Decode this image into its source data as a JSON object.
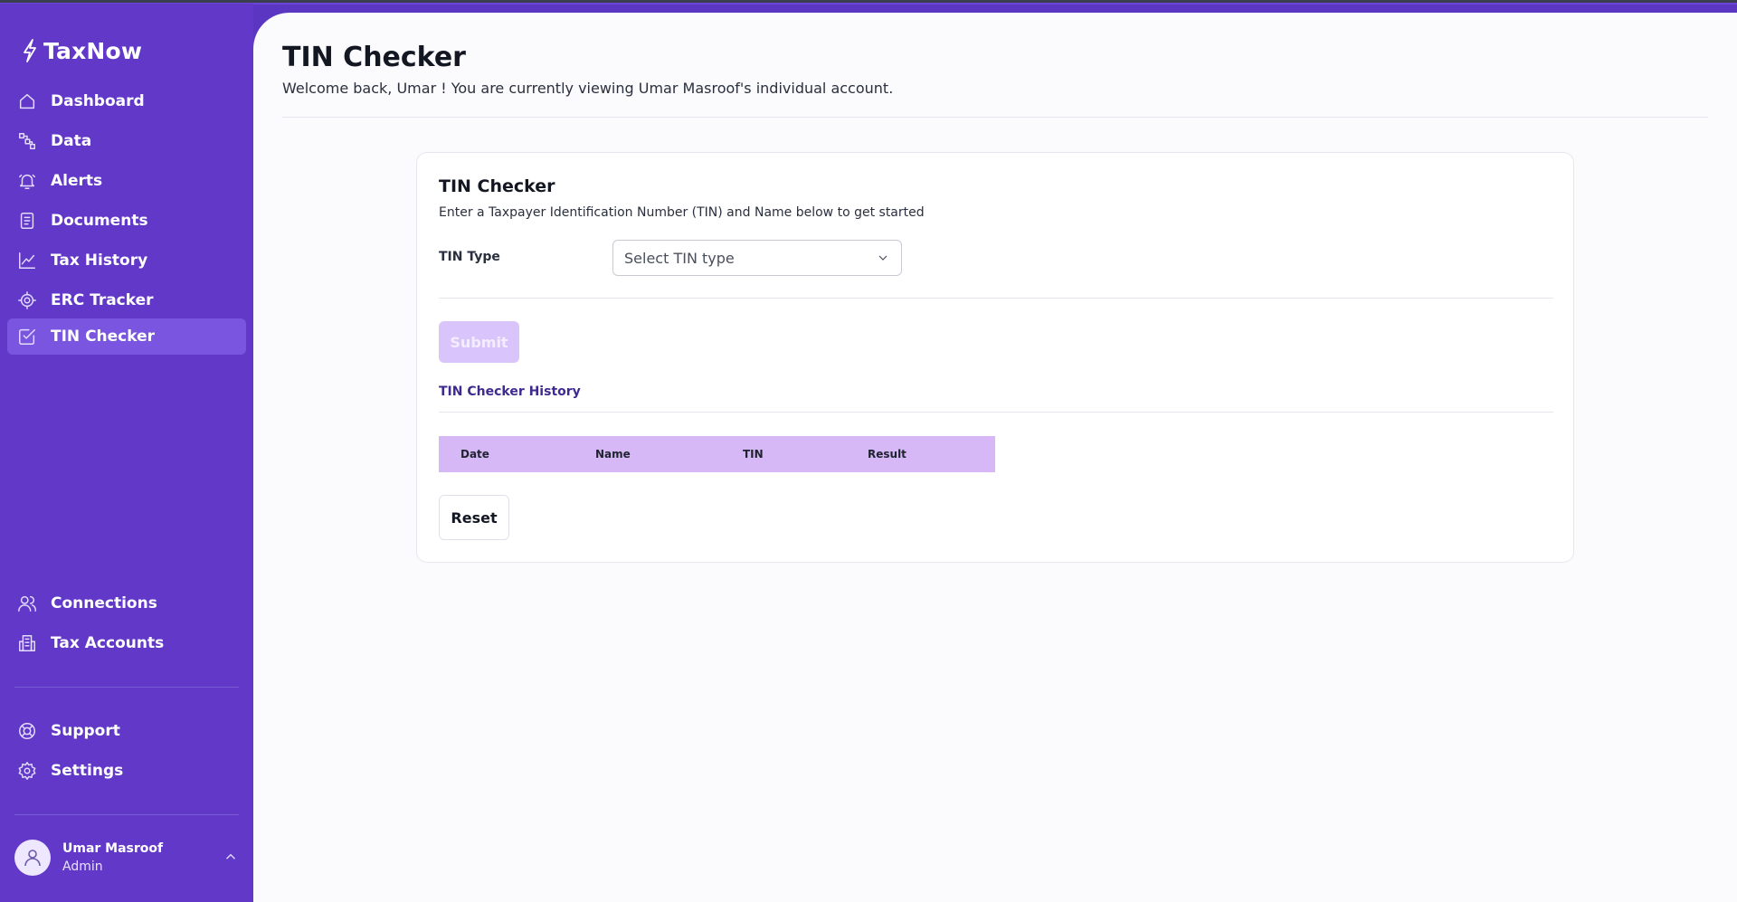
{
  "app": {
    "name": "TaxNow"
  },
  "sidebar": {
    "items": [
      {
        "label": "Dashboard",
        "icon": "home-icon"
      },
      {
        "label": "Data",
        "icon": "data-icon"
      },
      {
        "label": "Alerts",
        "icon": "bell-icon"
      },
      {
        "label": "Documents",
        "icon": "document-icon"
      },
      {
        "label": "Tax History",
        "icon": "chart-line-icon"
      },
      {
        "label": "ERC Tracker",
        "icon": "target-icon"
      },
      {
        "label": "TIN Checker",
        "icon": "check-square-icon",
        "active": true
      }
    ],
    "secondary": [
      {
        "label": "Connections",
        "icon": "users-icon"
      },
      {
        "label": "Tax Accounts",
        "icon": "building-icon"
      }
    ],
    "footer": [
      {
        "label": "Support",
        "icon": "lifebuoy-icon"
      },
      {
        "label": "Settings",
        "icon": "gear-icon"
      }
    ],
    "user": {
      "name": "Umar Masroof",
      "role": "Admin"
    }
  },
  "page": {
    "title": "TIN Checker",
    "subtitle": "Welcome back, Umar ! You are currently viewing Umar Masroof's individual account."
  },
  "card": {
    "title": "TIN Checker",
    "subtitle": "Enter a Taxpayer Identification Number (TIN) and Name below to get started",
    "tin_type_label": "TIN Type",
    "tin_type_placeholder": "Select TIN type",
    "submit_label": "Submit",
    "history_title": "TIN Checker History",
    "table_columns": [
      "Date",
      "Name",
      "TIN",
      "Result"
    ],
    "reset_label": "Reset"
  },
  "colors": {
    "sidebar_bg": "#6138c8",
    "active_item_bg": "#7a56e0",
    "table_header_bg": "#d6b8f6",
    "submit_disabled_bg": "#d9c4fb",
    "history_title": "#3f2a8f"
  }
}
